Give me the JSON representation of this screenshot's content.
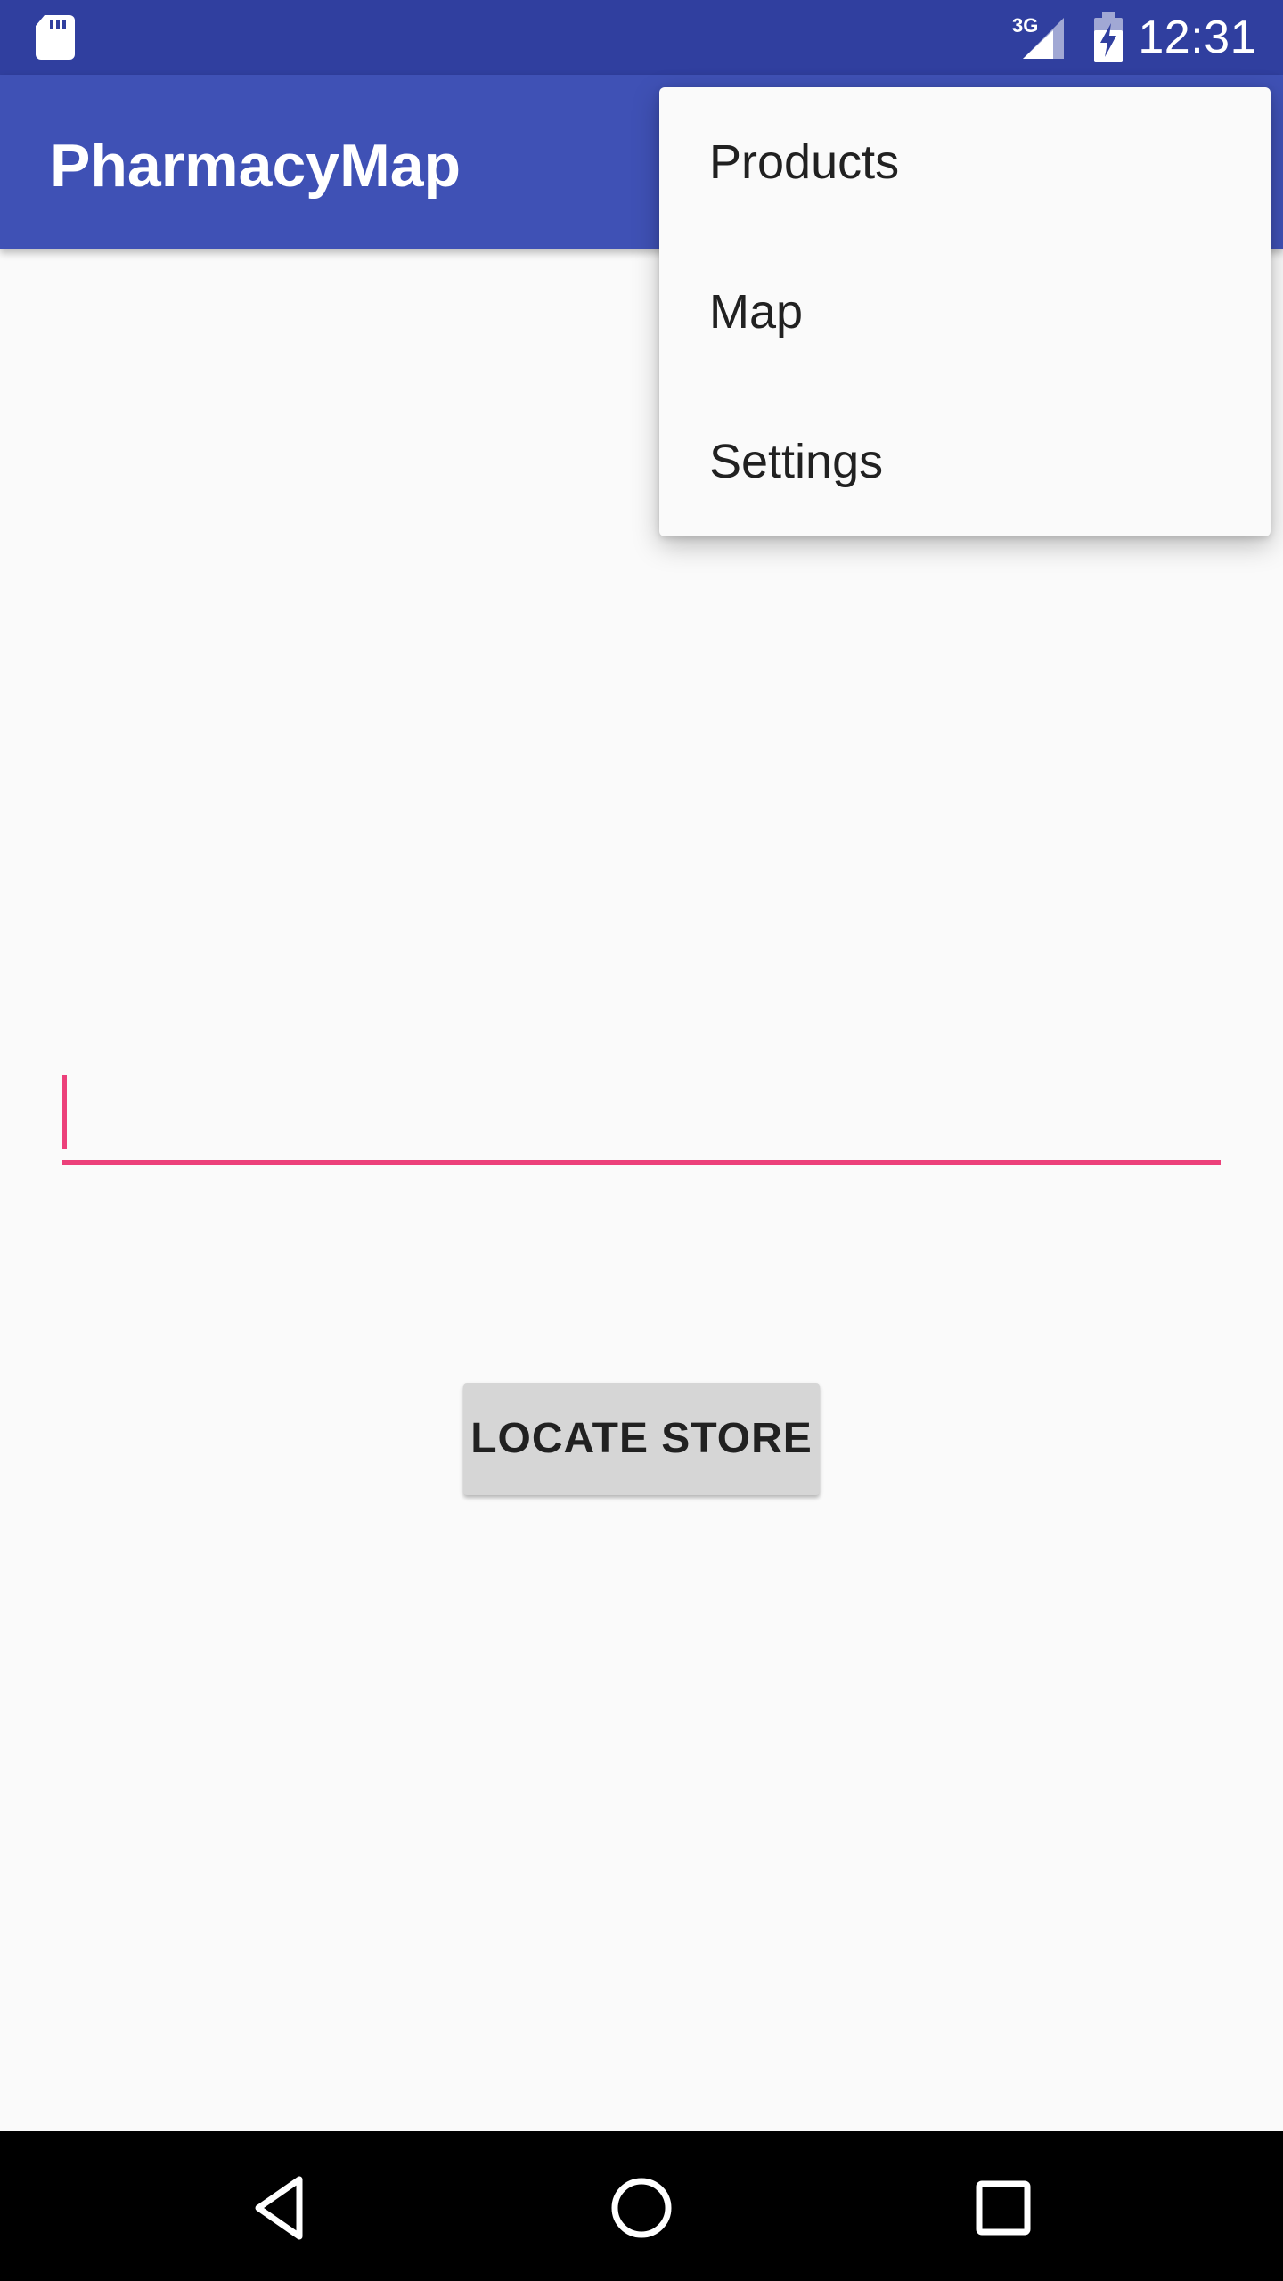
{
  "status_bar": {
    "time": "12:31",
    "network_type": "3G",
    "icons": [
      "sd-card-icon",
      "signal-icon",
      "battery-charging-icon"
    ]
  },
  "app_bar": {
    "title": "PharmacyMap"
  },
  "overflow_menu": {
    "items": [
      {
        "label": "Products"
      },
      {
        "label": "Map"
      },
      {
        "label": "Settings"
      }
    ]
  },
  "main": {
    "input": {
      "value": "",
      "placeholder": ""
    },
    "locate_button_label": "LOCATE STORE"
  },
  "nav_bar": {
    "icons": [
      "back-icon",
      "home-icon",
      "recents-icon"
    ]
  },
  "colors": {
    "status_bar": "#303f9f",
    "app_bar": "#3f51b5",
    "accent": "#ec407a",
    "button": "#d6d6d6",
    "background": "#fafafa"
  }
}
